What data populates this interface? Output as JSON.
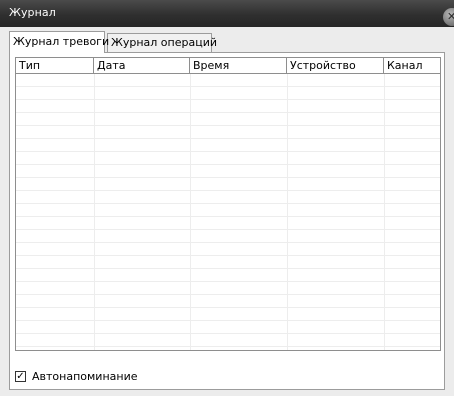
{
  "window": {
    "title": "Журнал",
    "close_glyph": "✕"
  },
  "tabs": [
    {
      "label": "Журнал тревоги",
      "active": true
    },
    {
      "label": "Журнал операций",
      "active": false
    }
  ],
  "table": {
    "columns": [
      "Тип",
      "Дата",
      "Время",
      "Устройство",
      "Канал"
    ],
    "rows": []
  },
  "auto_remind": {
    "label": "Автонапоминание",
    "checked": true,
    "check_glyph": "✓"
  },
  "colors": {
    "titlebar": "#2f2f2f",
    "window_bg": "#ececec",
    "grid_line": "#ededed",
    "border": "#8e8e8e"
  }
}
